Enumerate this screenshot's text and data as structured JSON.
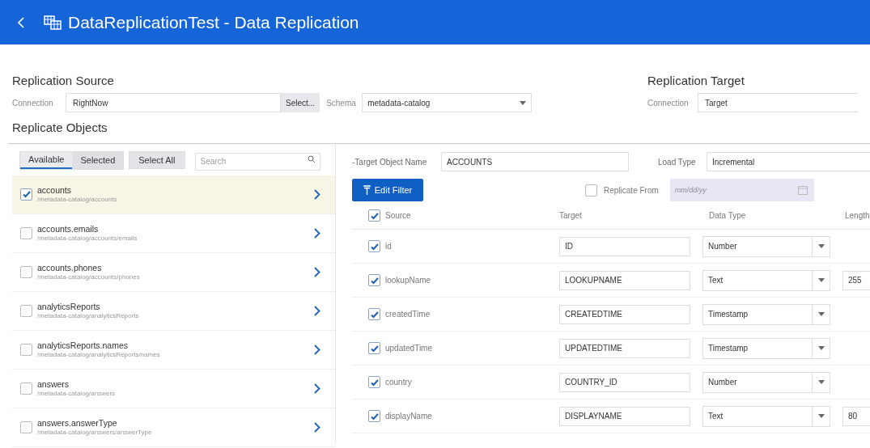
{
  "header": {
    "title": "DataReplicationTest - Data Replication"
  },
  "source": {
    "title": "Replication Source",
    "connection_label": "Connection",
    "connection_value": "RightNow",
    "select_button": "Select...",
    "schema_label": "Schema",
    "schema_value": "metadata-catalog"
  },
  "target": {
    "title": "Replication Target",
    "connection_label": "Connection",
    "connection_value": "Target"
  },
  "objects_title": "Replicate Objects",
  "tabs": [
    {
      "label": "Available",
      "selected": true
    },
    {
      "label": "Selected",
      "selected": false
    }
  ],
  "select_all": "Select All",
  "search": {
    "placeholder": "Search"
  },
  "objects": [
    {
      "name": "accounts",
      "path": "/metadata-catalog/accounts",
      "checked": true,
      "selected": true
    },
    {
      "name": "accounts.emails",
      "path": "/metadata-catalog/accounts/emails",
      "checked": false,
      "selected": false
    },
    {
      "name": "accounts.phones",
      "path": "/metadata-catalog/accounts/phones",
      "checked": false,
      "selected": false
    },
    {
      "name": "analyticsReports",
      "path": "/metadata-catalog/analyticsReports",
      "checked": false,
      "selected": false
    },
    {
      "name": "analyticsReports.names",
      "path": "/metadata-catalog/analyticsReports/names",
      "checked": false,
      "selected": false
    },
    {
      "name": "answers",
      "path": "/metadata-catalog/answers",
      "checked": false,
      "selected": false
    },
    {
      "name": "answers.answerType",
      "path": "/metadata-catalog/answers/answerType",
      "checked": false,
      "selected": false
    }
  ],
  "target_object": {
    "label": "-Target Object Name",
    "value": "ACCOUNTS"
  },
  "load_type": {
    "label": "Load Type",
    "value": "Incremental"
  },
  "edit_filter": "Edit Filter",
  "replicate_from": {
    "label": "Replicate From",
    "checked": false,
    "placeholder": "mm/dd/yy"
  },
  "mapping": {
    "all_checked": true,
    "columns": [
      "Source",
      "Target",
      "Data Type",
      "Length"
    ],
    "rows": [
      {
        "source": "id",
        "checked": true,
        "target": "ID",
        "data_type": "Number"
      },
      {
        "source": "lookupName",
        "checked": true,
        "target": "LOOKUPNAME",
        "data_type": "Text",
        "length": "255"
      },
      {
        "source": "createdTime",
        "checked": true,
        "target": "CREATEDTIME",
        "data_type": "Timestamp"
      },
      {
        "source": "updatedTime",
        "checked": true,
        "target": "UPDATEDTIME",
        "data_type": "Timestamp"
      },
      {
        "source": "country",
        "checked": true,
        "target": "COUNTRY_ID",
        "data_type": "Number"
      },
      {
        "source": "displayName",
        "checked": true,
        "target": "DISPLAYNAME",
        "data_type": "Text",
        "length": "80"
      }
    ]
  }
}
